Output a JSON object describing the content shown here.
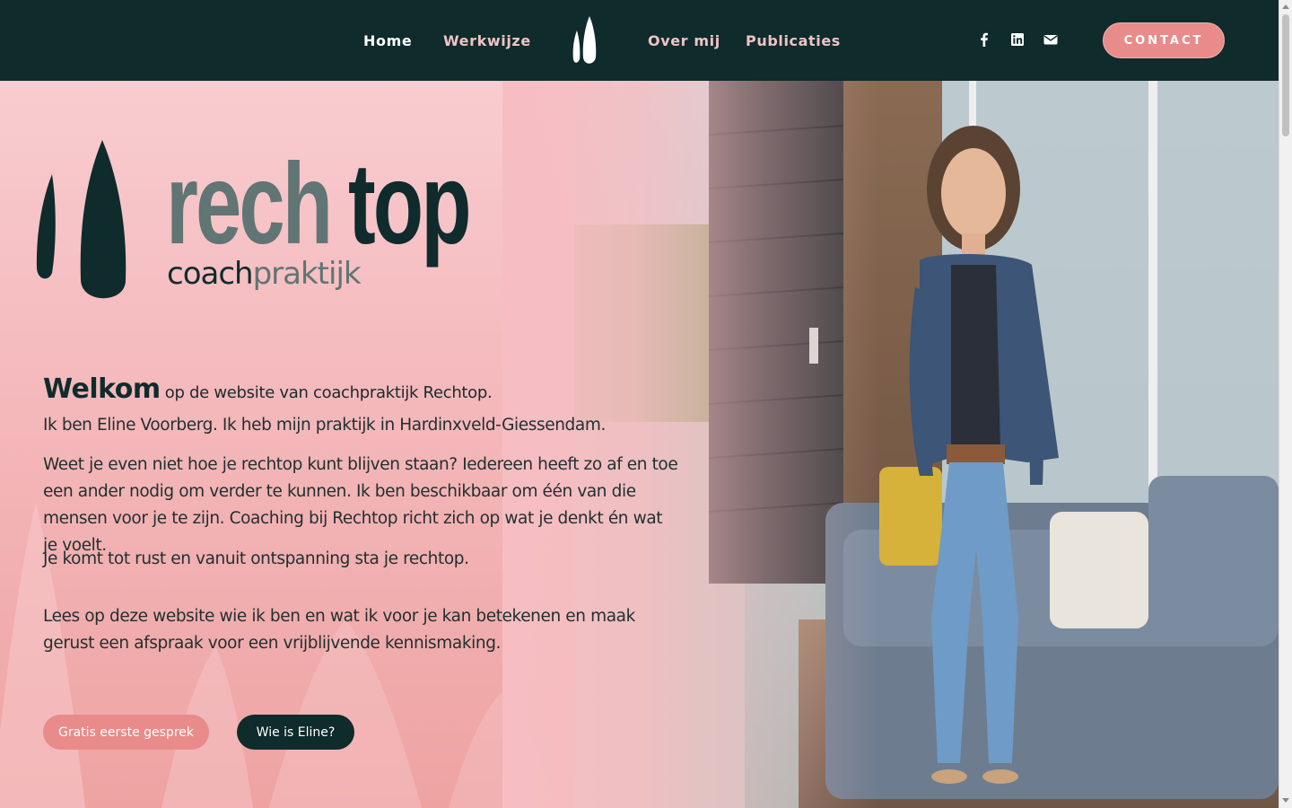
{
  "nav": {
    "items": [
      {
        "label": "Home",
        "active": true
      },
      {
        "label": "Werkwijze",
        "active": false
      },
      {
        "label": "Over mij",
        "active": false
      },
      {
        "label": "Publicaties",
        "active": false
      }
    ],
    "logo_icon": "rechtop-trees-icon",
    "social_icons": [
      "facebook-icon",
      "linkedin-icon",
      "mail-icon"
    ],
    "contact_label": "CONTACT"
  },
  "brand": {
    "word_light": "rech",
    "word_dark": "top",
    "sub_dark": "coach",
    "sub_light": "praktijk"
  },
  "hero": {
    "welcome_bold": "Welkom",
    "welcome_rest": "op de website van coachpraktijk Rechtop.",
    "intro": "Ik ben Eline Voorberg. Ik heb mijn praktijk in Hardinxveld-Giessendam.",
    "paragraph1": "Weet je even niet hoe je rechtop kunt blijven staan? Iedereen heeft zo af en toe een ander nodig om verder te kunnen. Ik ben beschikbaar om één van die mensen voor je te zijn. Coaching bij Rechtop richt zich op wat je denkt én wat je voelt.",
    "paragraph2": "Je komt tot rust en vanuit ontspanning sta je rechtop.",
    "paragraph3": "Lees op deze website wie ik ben en wat ik voor je kan betekenen en maak gerust een afspraak voor een vrijblijvende kennismaking.",
    "button_primary": "Gratis eerste gesprek",
    "button_secondary": "Wie is Eline?"
  },
  "colors": {
    "header_bg": "#0f2b2c",
    "accent_pink": "#e88b8a",
    "hero_bg": "#f4b8bb",
    "brand_gray": "#607574",
    "brand_dark": "#0f2b2c"
  }
}
